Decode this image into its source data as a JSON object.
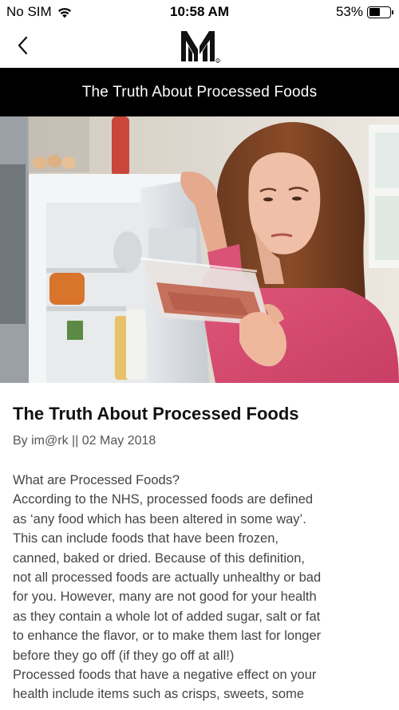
{
  "status_bar": {
    "carrier": "No SIM",
    "time": "10:58 AM",
    "battery_percent": "53%",
    "battery_level": 0.53,
    "wifi_icon": "wifi-icon",
    "battery_icon": "battery-icon"
  },
  "nav": {
    "back_icon": "chevron-left-icon",
    "logo_icon": "brand-logo-icon"
  },
  "header": {
    "title": "The Truth About Processed Foods"
  },
  "hero_image": {
    "subject": "woman-holding-packaged-meat-at-fridge"
  },
  "article": {
    "title": "The Truth About Processed Foods",
    "byline": "By im@rk || 02 May 2018",
    "lines": [
      "What are Processed Foods?",
      "According to the NHS, processed foods are defined",
      "as ‘any food which has been altered in some way’.",
      "This can include foods that have been frozen,",
      "canned, baked or dried. Because of this definition,",
      "not all processed foods are actually unhealthy or bad",
      "for you. However, many are not good for your health",
      "as they contain a whole lot of added sugar, salt or fat",
      "to enhance the flavor, or to make them last for longer",
      "before they go off (if they go off at all!)",
      "Processed foods that have a negative effect on your",
      "health include items such as crisps, sweets, some"
    ]
  }
}
